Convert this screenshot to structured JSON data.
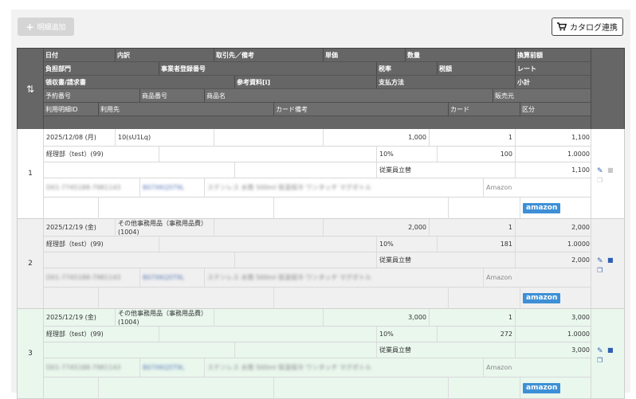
{
  "toolbar": {
    "add_label": "明細追加",
    "catalog_label": "カタログ連携"
  },
  "header": {
    "row1": [
      "日付",
      "内訳",
      "取引先／備考",
      "単価",
      "数量",
      "換算前額"
    ],
    "row2": [
      "負担部門",
      "事業者登録番号",
      "税率",
      "税額",
      "レート"
    ],
    "row3": [
      "領収書/請求書",
      "参考資料[i]",
      "支払方法",
      "小計"
    ],
    "row4": [
      "予約番号",
      "商品番号",
      "商品名",
      "販売元"
    ],
    "row5": [
      "利用明細ID",
      "利用先",
      "カード備考",
      "カード",
      "区分"
    ]
  },
  "records": [
    {
      "num": "1",
      "date": "2025/12/08 (月)",
      "breakdown": "10(sU1Lq)",
      "unit_price": "1,000",
      "qty": "1",
      "pre_amount": "1,100",
      "dept": "経理部（test）(99)",
      "tax_rate": "10%",
      "tax_amount": "100",
      "rate": "1.0000",
      "payment": "従業員立替",
      "subtotal": "1,100",
      "seller": "Amazon",
      "category": "amazon",
      "blur_a": "D01-7745188-7981143",
      "blur_b": "B07XKQ5T9L",
      "blur_c": "ステンレス 水筒 500ml 保温保冷 ワンタッチ マグボトル"
    },
    {
      "num": "2",
      "date": "2025/12/19 (金)",
      "breakdown": "その他事務用品（事務用品費）(1004)",
      "unit_price": "2,000",
      "qty": "1",
      "pre_amount": "2,000",
      "dept": "経理部（test）(99)",
      "tax_rate": "10%",
      "tax_amount": "181",
      "rate": "1.0000",
      "payment": "従業員立替",
      "subtotal": "2,000",
      "seller": "Amazon",
      "category": "amazon",
      "blur_a": "D01-7745188-7981143",
      "blur_b": "B07XKQ5T9L",
      "blur_c": "ステンレス 水筒 500ml 保温保冷 ワンタッチ マグボトル"
    },
    {
      "num": "3",
      "date": "2025/12/19 (金)",
      "breakdown": "その他事務用品（事務用品費）(1004)",
      "unit_price": "3,000",
      "qty": "1",
      "pre_amount": "3,000",
      "dept": "経理部（test）(99)",
      "tax_rate": "10%",
      "tax_amount": "272",
      "rate": "1.0000",
      "payment": "従業員立替",
      "subtotal": "3,000",
      "seller": "Amazon",
      "category": "amazon",
      "blur_a": "D01-7745188-7981143",
      "blur_b": "B07XKQ5T9L",
      "blur_c": "ステンレス 水筒 500ml 保温保冷 ワンタッチ マグボトル"
    }
  ],
  "icons": {
    "cart": "cart-icon",
    "sort": "sort-arrows-icon",
    "edit": "pencil-icon",
    "delete": "trash-icon",
    "copy": "copy-icon"
  },
  "colors": {
    "header_bg": "#666666",
    "row_green": "#e9f7ed",
    "row_gray": "#f0f0f0",
    "amazon_badge": "#3d8fd6",
    "action_icon": "#2f5fb3"
  }
}
